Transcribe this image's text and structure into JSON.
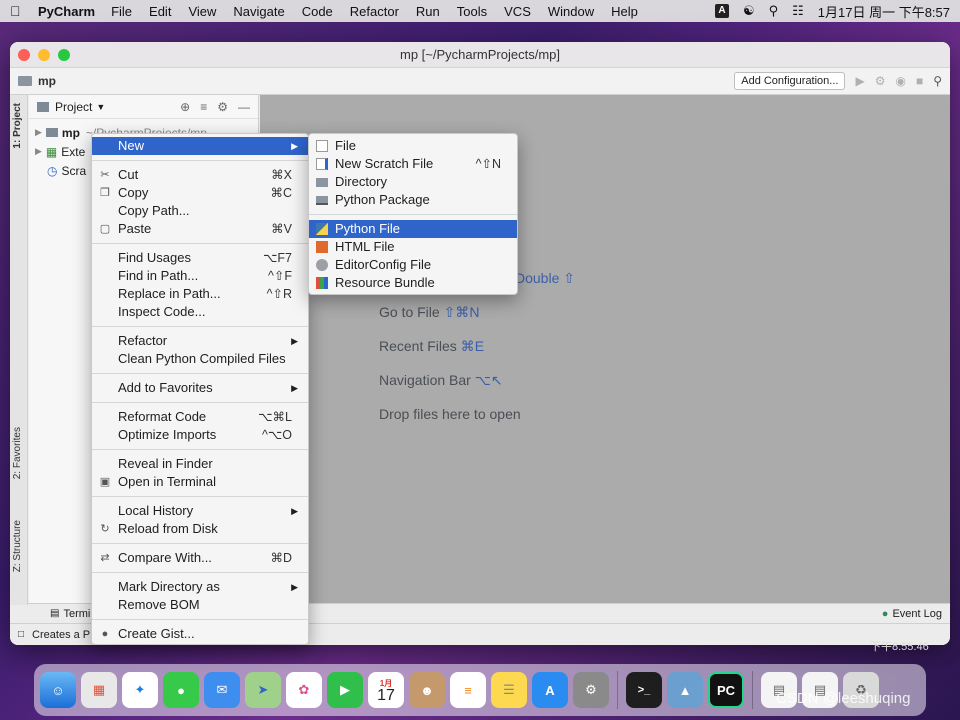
{
  "menubar": {
    "app_name": "PyCharm",
    "items": [
      "File",
      "Edit",
      "View",
      "Navigate",
      "Code",
      "Refactor",
      "Run",
      "Tools",
      "VCS",
      "Window",
      "Help"
    ],
    "input_indicator": "A",
    "datetime": "1月17日 周一 下午8:57"
  },
  "window": {
    "title": "mp [~/PycharmProjects/mp]",
    "breadcrumb": "mp",
    "add_configuration": "Add Configuration..."
  },
  "left_strip": {
    "project_tab": "1: Project",
    "favorites_tab": "2: Favorites",
    "structure_tab": "Z: Structure"
  },
  "project_panel": {
    "title": "Project",
    "tree": [
      {
        "label": "mp",
        "extra": "~/PycharmProjects/mp"
      },
      {
        "label": "Exte"
      },
      {
        "label": "Scra"
      }
    ]
  },
  "editor_hints": [
    {
      "text": "Double",
      "key": "⇧"
    },
    {
      "text": "Go to File",
      "key": "⇧⌘N"
    },
    {
      "text": "Recent Files",
      "key": "⌘E"
    },
    {
      "text": "Navigation Bar",
      "key": "⌥↖"
    },
    {
      "text": "Drop files here to open",
      "key": ""
    }
  ],
  "bottom": {
    "terminal": "Termina",
    "event_log": "Event Log",
    "status": "Creates a P"
  },
  "context_menu": {
    "groups": [
      [
        {
          "label": "New",
          "submenu": true,
          "selected": true
        }
      ],
      [
        {
          "label": "Cut",
          "shortcut": "⌘X",
          "icon": "scissors-icon"
        },
        {
          "label": "Copy",
          "shortcut": "⌘C",
          "icon": "copy-icon"
        },
        {
          "label": "Copy Path..."
        },
        {
          "label": "Paste",
          "shortcut": "⌘V",
          "icon": "paste-icon"
        }
      ],
      [
        {
          "label": "Find Usages",
          "shortcut": "⌥F7"
        },
        {
          "label": "Find in Path...",
          "shortcut": "^⇧F"
        },
        {
          "label": "Replace in Path...",
          "shortcut": "^⇧R"
        },
        {
          "label": "Inspect Code..."
        }
      ],
      [
        {
          "label": "Refactor",
          "submenu": true
        },
        {
          "label": "Clean Python Compiled Files"
        }
      ],
      [
        {
          "label": "Add to Favorites",
          "submenu": true
        }
      ],
      [
        {
          "label": "Reformat Code",
          "shortcut": "⌥⌘L"
        },
        {
          "label": "Optimize Imports",
          "shortcut": "^⌥O"
        }
      ],
      [
        {
          "label": "Reveal in Finder"
        },
        {
          "label": "Open in Terminal",
          "icon": "terminal-icon"
        }
      ],
      [
        {
          "label": "Local History",
          "submenu": true
        },
        {
          "label": "Reload from Disk",
          "icon": "reload-icon"
        }
      ],
      [
        {
          "label": "Compare With...",
          "shortcut": "⌘D",
          "icon": "compare-icon"
        }
      ],
      [
        {
          "label": "Mark Directory as",
          "submenu": true
        },
        {
          "label": "Remove BOM"
        }
      ],
      [
        {
          "label": "Create Gist...",
          "icon": "github-icon"
        }
      ]
    ]
  },
  "submenu": {
    "groups": [
      [
        {
          "label": "File",
          "icon": "file-icon"
        },
        {
          "label": "New Scratch File",
          "shortcut": "^⇧N",
          "icon": "scratch-file-icon"
        },
        {
          "label": "Directory",
          "icon": "folder-icon"
        },
        {
          "label": "Python Package",
          "icon": "package-icon"
        }
      ],
      [
        {
          "label": "Python File",
          "selected": true,
          "icon": "python-icon"
        },
        {
          "label": "HTML File",
          "icon": "html-icon"
        },
        {
          "label": "EditorConfig File",
          "icon": "gear-icon"
        },
        {
          "label": "Resource Bundle",
          "icon": "bundle-icon"
        }
      ]
    ]
  },
  "dock_apps": [
    "finder",
    "launchpad",
    "safari",
    "messages",
    "mail",
    "maps",
    "photos",
    "facetime",
    "calendar",
    "contacts",
    "reminders",
    "notes",
    "app-store",
    "system-preferences",
    "terminal",
    "preview",
    "pycharm",
    "document",
    "document-2",
    "trash"
  ],
  "calendar_day": "17",
  "calendar_month": "1月",
  "desktop_clock": "下午8:55:46",
  "watermark": "CSDN @leeshuqing",
  "colors": {
    "selection": "#2f65ca",
    "shortcut_hint": "#3a5fa8"
  }
}
